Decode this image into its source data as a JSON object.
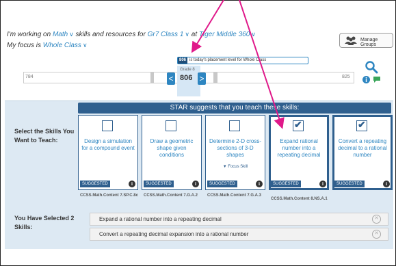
{
  "header": {
    "prefix": "I'm working on",
    "subject": "Math",
    "mid": "skills and resources for",
    "class_name": "Gr7 Class 1",
    "at": "at",
    "school": "Tiger Middle 360",
    "focus_prefix": "My focus is",
    "focus": "Whole Class",
    "chevron": "∨"
  },
  "manage_groups": {
    "label": "Manage Groups",
    "icon": "people-icon"
  },
  "placement": {
    "badge": "806",
    "message": "is today's placement level for Whole Class",
    "grade": "Grade 8",
    "score": "806",
    "low": "784",
    "high": "825",
    "prev": "<",
    "next": ">"
  },
  "tools": {
    "search_icon": "search-icon",
    "info_icon": "info-icon",
    "chat_icon": "chat-icon"
  },
  "banner": "STAR suggests that you teach these skills:",
  "select_header": "Select the Skills You Want to Teach:",
  "cards": [
    {
      "title": "Design a simulation for a compound event",
      "badge": "SUGGESTED",
      "checked": false,
      "standard": "CCSS.Math.Content 7.SP.C.8c"
    },
    {
      "title": "Draw a geometric shape given conditions",
      "badge": "SUGGESTED",
      "checked": false,
      "standard": "CCSS.Math.Content 7.G.A.2"
    },
    {
      "title": "Determine 2-D cross-sections of 3-D shapes",
      "badge": "SUGGESTED",
      "checked": false,
      "focus": "▼ Focus Skill",
      "standard": "CCSS.Math.Content 7.G.A.3"
    },
    {
      "title": "Expand rational number into a repeating decimal",
      "badge": "SUGGESTED",
      "checked": true,
      "standard": "CCSS.Math.Content 8.NS.A.1"
    },
    {
      "title": "Convert a repeating decimal to a rational number",
      "badge": "SUGGESTED",
      "checked": true,
      "standard": ""
    }
  ],
  "selected_header": "You Have Selected 2 Skills:",
  "selected": [
    "Expand a rational number into a repeating decimal",
    "Convert a repeating decimal expansion into a rational number"
  ],
  "colors": {
    "accent": "#2e86c1",
    "dark_blue": "#2f5f8e",
    "annotation": "#e0198a"
  }
}
